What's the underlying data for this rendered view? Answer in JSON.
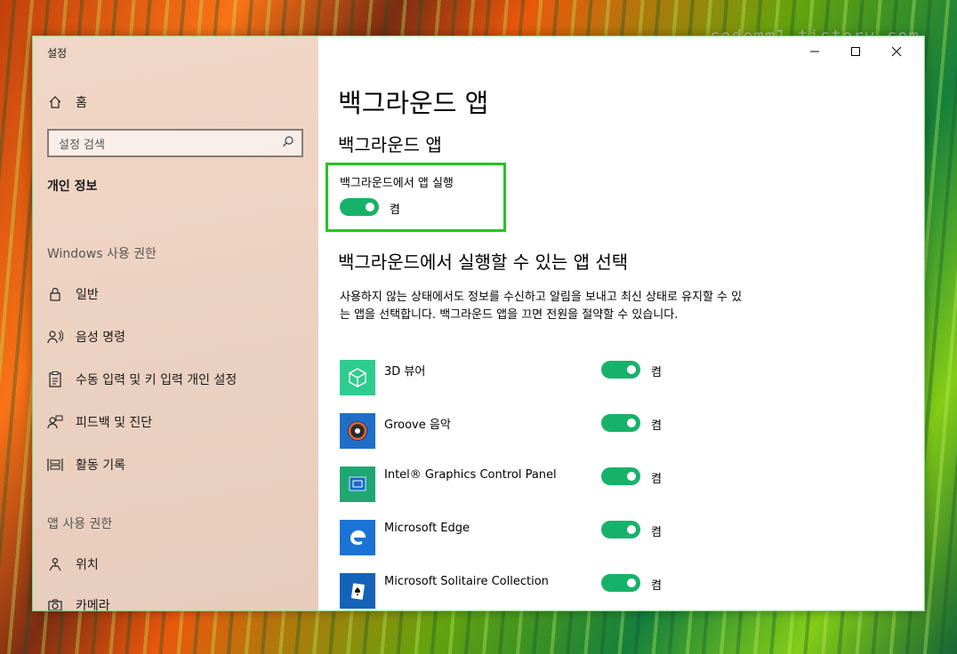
{
  "watermark": "codemm1.tistory.com",
  "window": {
    "title": "설정"
  },
  "sidebar": {
    "home": "홈",
    "search_placeholder": "설정 검색",
    "section_title": "개인 정보",
    "windows_perm_header": "Windows 사용 권한",
    "windows_items": [
      {
        "label": "일반",
        "icon": "lock-icon"
      },
      {
        "label": "음성 명령",
        "icon": "speech-icon"
      },
      {
        "label": "수동 입력 및 키 입력 개인 설정",
        "icon": "clipboard-icon"
      },
      {
        "label": "피드백 및 진단",
        "icon": "feedback-icon"
      },
      {
        "label": "활동 기록",
        "icon": "timeline-icon"
      }
    ],
    "app_perm_header": "앱 사용 권한",
    "app_items": [
      {
        "label": "위치",
        "icon": "location-icon"
      },
      {
        "label": "카메라",
        "icon": "camera-icon"
      }
    ]
  },
  "main": {
    "page_title": "백그라운드 앱",
    "section1_title": "백그라운드 앱",
    "run_label": "백그라운드에서 앱 실행",
    "run_state": "켬",
    "section2_title": "백그라운드에서 실행할 수 있는 앱 선택",
    "description": "사용하지 않는 상태에서도 정보를 수신하고 알림을 보내고 최신 상태로 유지할 수 있는 앱을 선택합니다. 백그라운드 앱을 끄면 전원을 절약할 수 있습니다.",
    "apps": [
      {
        "name": "3D 뷰어",
        "state": "켬",
        "icon": "cube-icon",
        "color": "#2ecc8f"
      },
      {
        "name": "Groove 음악",
        "state": "켬",
        "icon": "groove-music-icon",
        "color": "#1f6fc9"
      },
      {
        "name": "Intel® Graphics Control Panel",
        "state": "켬",
        "icon": "intel-graphics-icon",
        "color": "#1fa672"
      },
      {
        "name": "Microsoft Edge",
        "state": "켬",
        "icon": "edge-icon",
        "color": "#1b73d6"
      },
      {
        "name": "Microsoft Solitaire Collection",
        "state": "켬",
        "icon": "solitaire-icon",
        "color": "#1463b8"
      }
    ]
  },
  "colors": {
    "toggle_on": "#17b26a",
    "highlight": "#22c522"
  }
}
